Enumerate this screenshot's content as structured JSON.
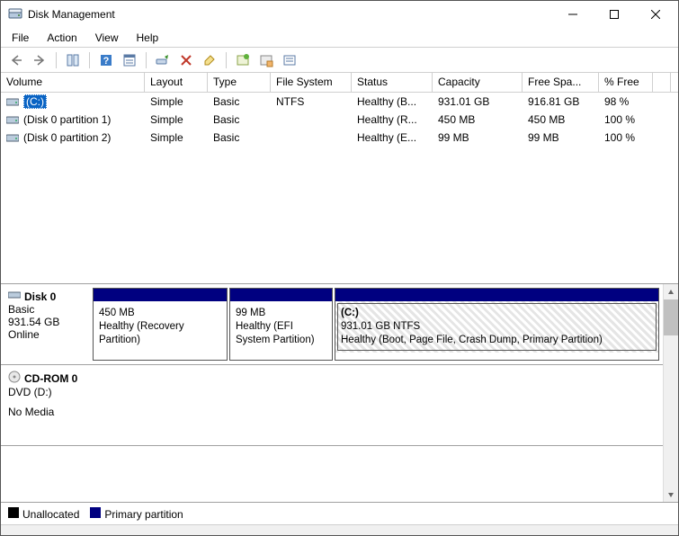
{
  "window": {
    "title": "Disk Management"
  },
  "menu": {
    "file": "File",
    "action": "Action",
    "view": "View",
    "help": "Help"
  },
  "table": {
    "headers": [
      "Volume",
      "Layout",
      "Type",
      "File System",
      "Status",
      "Capacity",
      "Free Spa...",
      "% Free"
    ],
    "rows": [
      {
        "volume": "(C:)",
        "layout": "Simple",
        "type": "Basic",
        "fs": "NTFS",
        "status": "Healthy (B...",
        "capacity": "931.01 GB",
        "free": "916.81 GB",
        "pct": "98 %",
        "selected": true,
        "icon": "drive"
      },
      {
        "volume": "(Disk 0 partition 1)",
        "layout": "Simple",
        "type": "Basic",
        "fs": "",
        "status": "Healthy (R...",
        "capacity": "450 MB",
        "free": "450 MB",
        "pct": "100 %",
        "selected": false,
        "icon": "drive"
      },
      {
        "volume": "(Disk 0 partition 2)",
        "layout": "Simple",
        "type": "Basic",
        "fs": "",
        "status": "Healthy (E...",
        "capacity": "99 MB",
        "free": "99 MB",
        "pct": "100 %",
        "selected": false,
        "icon": "drive"
      }
    ]
  },
  "disks": {
    "disk0": {
      "name": "Disk 0",
      "type": "Basic",
      "size": "931.54 GB",
      "status": "Online",
      "partitions": [
        {
          "vol": "",
          "size": "450 MB",
          "health": "Healthy (Recovery Partition)",
          "selected": false
        },
        {
          "vol": "",
          "size": "99 MB",
          "health": "Healthy (EFI System Partition)",
          "selected": false
        },
        {
          "vol": "(C:)",
          "size": "931.01 GB NTFS",
          "health": "Healthy (Boot, Page File, Crash Dump, Primary Partition)",
          "selected": true
        }
      ]
    },
    "cdrom": {
      "name": "CD-ROM 0",
      "type": "DVD (D:)",
      "status": "No Media"
    }
  },
  "legend": {
    "unallocated": "Unallocated",
    "primary": "Primary partition"
  }
}
